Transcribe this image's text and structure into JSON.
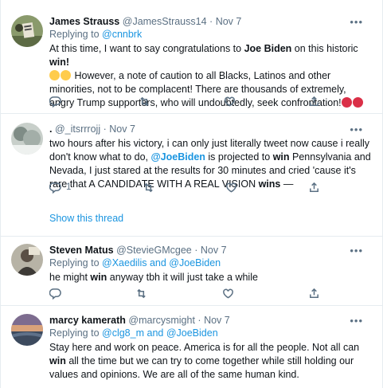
{
  "more_icon": "•••",
  "tweets": [
    {
      "name": "James Strauss",
      "handle": "@JamesStrauss14",
      "dot": "·",
      "date": "Nov 7",
      "reply_prefix": "Replying to ",
      "reply_to_1": "@cnnbrk",
      "reply_and": "",
      "reply_to_2": "",
      "text_segments": [
        "At this time, I want to say congratulations to ",
        "Joe Biden",
        " on this historic ",
        "win",
        "! ",
        " However, a note of caution to all Blacks, Latinos and other minorities, not to be complacent! There are thousands of extremely, angry Trump supporters, who will undoubtedly, seek confrontation!"
      ],
      "reply_count": "",
      "retweet_count": "",
      "like_count": ""
    },
    {
      "name": ".",
      "handle": "@_itsrrrojj",
      "dot": "·",
      "date": "Nov 7",
      "text_segments": [
        "two hours after his victory, i can only just literally tweet now cause i really don't know what to do, ",
        "@JoeBiden",
        " is projected to ",
        "win",
        " Pennsylvania and Nevada, I just stared at the results for 30 minutes and cried 'cause it's rare that A CANDIDATE WITH A REAL VISION ",
        "wins",
        " —"
      ],
      "reply_count": "1",
      "retweet_count": "",
      "like_count": "",
      "show_thread": "Show this thread"
    },
    {
      "name": "Steven Matus",
      "handle": "@StevieGMcgee",
      "dot": "·",
      "date": "Nov 7",
      "reply_prefix": "Replying to ",
      "reply_to_1": "@Xaedilis",
      "reply_and": " and ",
      "reply_to_2": "@JoeBiden",
      "text_segments": [
        "he might ",
        "win",
        " anyway tbh it will just take a while"
      ],
      "reply_count": "",
      "retweet_count": "",
      "like_count": ""
    },
    {
      "name": "marcy kamerath",
      "handle": "@marcysmight",
      "dot": "·",
      "date": "Nov 7",
      "reply_prefix": "Replying to ",
      "reply_to_1": "@clg8_m",
      "reply_and": " and ",
      "reply_to_2": "@JoeBiden",
      "text_segments": [
        "Stay here and work on peace. America is for all the people. Not all can ",
        "win",
        " all the time but we can try to come together while still holding our values and opinions. We are all of the same human kind."
      ]
    }
  ]
}
